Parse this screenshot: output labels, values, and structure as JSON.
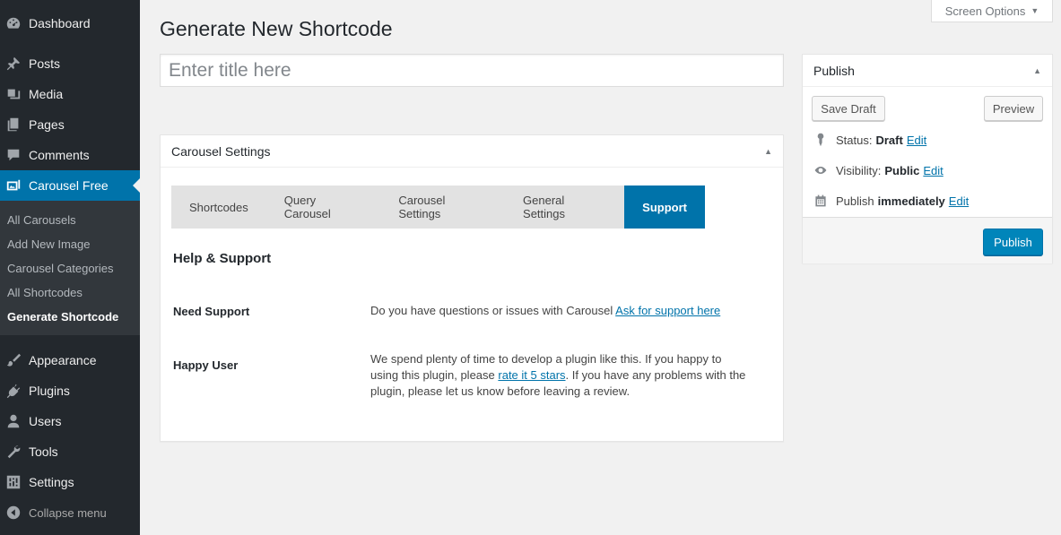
{
  "sidebar": {
    "items": [
      {
        "label": "Dashboard",
        "icon": "dashboard-icon"
      },
      {
        "label": "Posts",
        "icon": "pin-icon"
      },
      {
        "label": "Media",
        "icon": "media-icon"
      },
      {
        "label": "Pages",
        "icon": "pages-icon"
      },
      {
        "label": "Comments",
        "icon": "comment-icon"
      },
      {
        "label": "Carousel Free",
        "icon": "images-icon"
      },
      {
        "label": "Appearance",
        "icon": "brush-icon"
      },
      {
        "label": "Plugins",
        "icon": "plugin-icon"
      },
      {
        "label": "Users",
        "icon": "user-icon"
      },
      {
        "label": "Tools",
        "icon": "wrench-icon"
      },
      {
        "label": "Settings",
        "icon": "settings-icon"
      }
    ],
    "submenu": [
      "All Carousels",
      "Add New Image",
      "Carousel Categories",
      "All Shortcodes",
      "Generate Shortcode"
    ],
    "collapse_label": "Collapse menu",
    "accent": "#0073aa"
  },
  "screen_options": "Screen Options",
  "page_title": "Generate New Shortcode",
  "title_placeholder": "Enter title here",
  "carousel_box": {
    "title": "Carousel Settings",
    "tabs": [
      "Shortcodes",
      "Query Carousel",
      "Carousel Settings",
      "General Settings",
      "Support"
    ],
    "active_tab": "Support",
    "content_title": "Help & Support",
    "need_support": {
      "label": "Need Support",
      "text": "Do you have questions or issues with Carousel",
      "link": "Ask for support here"
    },
    "happy_user": {
      "label": "Happy User",
      "text_before": "We spend plenty of time to develop a plugin like this. If you happy to using this plugin, please",
      "link": "rate it 5 stars",
      "text_after": ". If you have any problems with the plugin, please let us know before leaving a review."
    }
  },
  "publish": {
    "title": "Publish",
    "save_draft": "Save Draft",
    "preview": "Preview",
    "status_label": "Status:",
    "status_value": "Draft",
    "visibility_label": "Visibility:",
    "visibility_value": "Public",
    "schedule_label": "Publish",
    "schedule_value": "immediately",
    "edit": "Edit",
    "publish_button": "Publish"
  }
}
